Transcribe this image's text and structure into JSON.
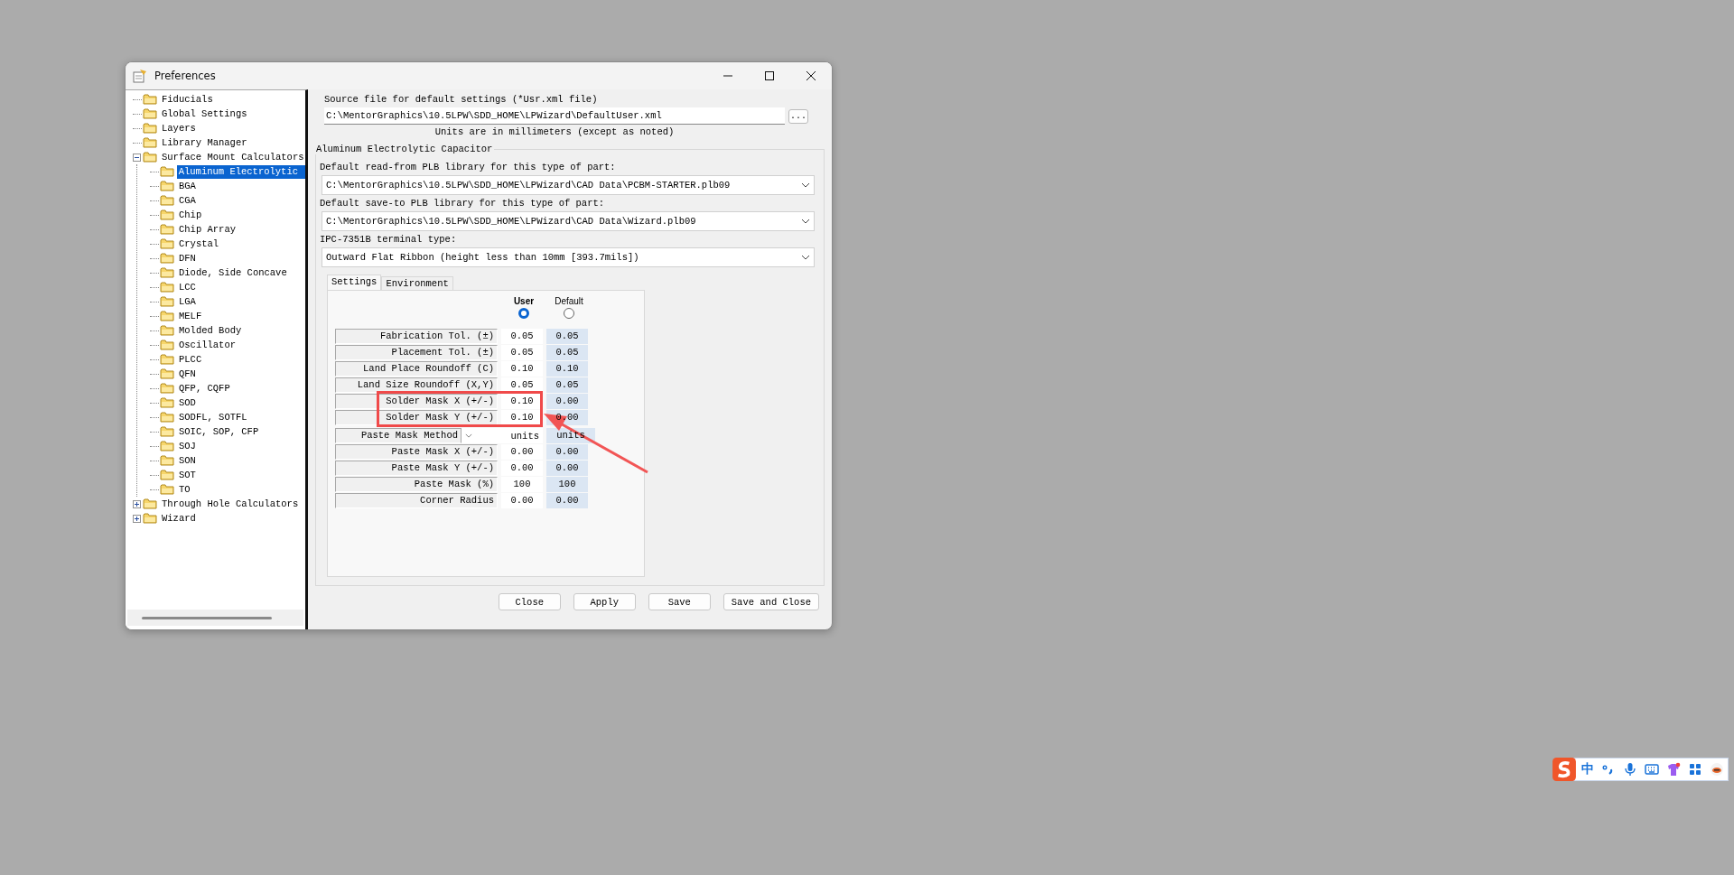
{
  "window": {
    "title": "Preferences"
  },
  "tree": [
    {
      "label": "Fiducials",
      "selected": false
    },
    {
      "label": "Global Settings",
      "selected": false
    },
    {
      "label": "Layers",
      "selected": false
    },
    {
      "label": "Library Manager",
      "selected": false
    },
    {
      "label": "Surface Mount Calculators",
      "selected": false,
      "expanded": true,
      "children": [
        {
          "label": "Aluminum Electrolytic",
          "selected": true
        },
        {
          "label": "BGA",
          "selected": false
        },
        {
          "label": "CGA",
          "selected": false
        },
        {
          "label": "Chip",
          "selected": false
        },
        {
          "label": "Chip Array",
          "selected": false
        },
        {
          "label": "Crystal",
          "selected": false
        },
        {
          "label": "DFN",
          "selected": false
        },
        {
          "label": "Diode, Side Concave",
          "selected": false
        },
        {
          "label": "LCC",
          "selected": false
        },
        {
          "label": "LGA",
          "selected": false
        },
        {
          "label": "MELF",
          "selected": false
        },
        {
          "label": "Molded Body",
          "selected": false
        },
        {
          "label": "Oscillator",
          "selected": false
        },
        {
          "label": "PLCC",
          "selected": false
        },
        {
          "label": "QFN",
          "selected": false
        },
        {
          "label": "QFP, CQFP",
          "selected": false
        },
        {
          "label": "SOD",
          "selected": false
        },
        {
          "label": "SODFL, SOTFL",
          "selected": false
        },
        {
          "label": "SOIC, SOP, CFP",
          "selected": false
        },
        {
          "label": "SOJ",
          "selected": false
        },
        {
          "label": "SON",
          "selected": false
        },
        {
          "label": "SOT",
          "selected": false
        },
        {
          "label": "TO",
          "selected": false
        }
      ]
    },
    {
      "label": "Through Hole Calculators",
      "selected": false,
      "expanded": false
    },
    {
      "label": "Wizard",
      "selected": false,
      "expanded": false
    }
  ],
  "source": {
    "label": "Source file for default settings (*Usr.xml file)",
    "value": "C:\\MentorGraphics\\10.5LPW\\SDD_HOME\\LPWizard\\DefaultUser.xml",
    "browse": "..."
  },
  "units_note": "Units are in millimeters (except as noted)",
  "group": {
    "title": "Aluminum Electrolytic Capacitor",
    "fields": [
      {
        "label": "Default read-from PLB library for this type of part:",
        "value": "C:\\MentorGraphics\\10.5LPW\\SDD_HOME\\LPWizard\\CAD Data\\PCBM-STARTER.plb09"
      },
      {
        "label": "Default save-to PLB library for this type of part:",
        "value": "C:\\MentorGraphics\\10.5LPW\\SDD_HOME\\LPWizard\\CAD Data\\Wizard.plb09"
      },
      {
        "label": "IPC-7351B terminal type:",
        "value": "Outward Flat Ribbon (height less than 10mm [393.7mils])"
      }
    ]
  },
  "tabs": [
    {
      "label": "Settings",
      "selected": true
    },
    {
      "label": "Environment",
      "selected": false
    }
  ],
  "value_source": [
    {
      "label": "User",
      "selected": true
    },
    {
      "label": "Default",
      "selected": false
    }
  ],
  "rows": [
    {
      "kind": "value",
      "label": "Fabrication Tol. (±)",
      "user": "0.05",
      "default": "0.05"
    },
    {
      "kind": "value",
      "label": "Placement Tol. (±)",
      "user": "0.05",
      "default": "0.05"
    },
    {
      "kind": "value",
      "label": "Land Place Roundoff (C)",
      "user": "0.10",
      "default": "0.10"
    },
    {
      "kind": "value",
      "label": "Land Size Roundoff (X,Y)",
      "user": "0.05",
      "default": "0.05"
    },
    {
      "kind": "value",
      "label": "Solder Mask X (+/-)",
      "user": "0.10",
      "default": "0.00"
    },
    {
      "kind": "value",
      "label": "Solder Mask Y (+/-)",
      "user": "0.10",
      "default": "0.00"
    },
    {
      "kind": "method",
      "label": "Paste Mask Method",
      "user": "units",
      "default": "units"
    },
    {
      "kind": "value",
      "label": "Paste Mask X (+/-)",
      "user": "0.00",
      "default": "0.00"
    },
    {
      "kind": "value",
      "label": "Paste Mask Y (+/-)",
      "user": "0.00",
      "default": "0.00"
    },
    {
      "kind": "value",
      "label": "Paste Mask (%)",
      "user": "100",
      "default": "100"
    },
    {
      "kind": "value",
      "label": "Corner Radius",
      "user": "0.00",
      "default": "0.00"
    }
  ],
  "buttons": [
    "Close",
    "Apply",
    "Save",
    "Save and Close"
  ],
  "ime": {
    "mode": "中"
  }
}
